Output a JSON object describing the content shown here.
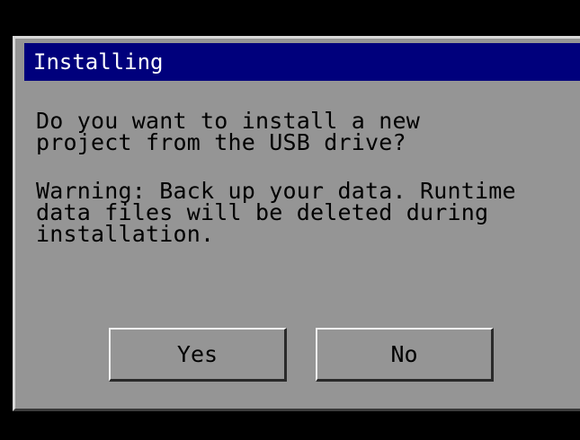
{
  "dialog": {
    "title": "Installing",
    "question": "Do you want to install a new\nproject from the USB drive?",
    "warning": "Warning: Back up your data. Runtime\ndata files will be deleted during\ninstallation.",
    "yes_label": "Yes",
    "no_label": "No"
  },
  "colors": {
    "title_bar": "#00007c",
    "dialog_background": "#959595",
    "screen_background": "#000000"
  }
}
